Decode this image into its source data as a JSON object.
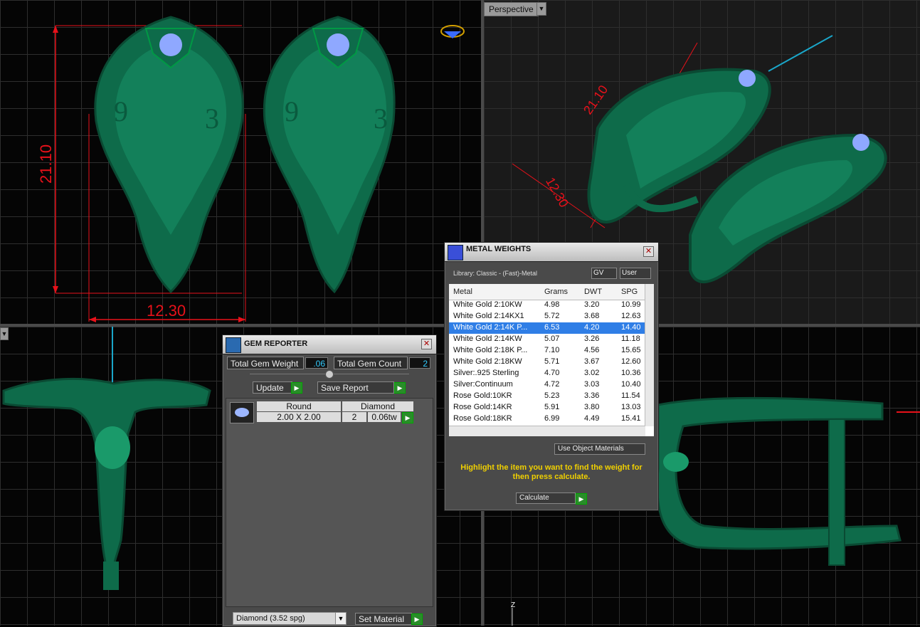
{
  "viewports": {
    "perspective_label": "Perspective",
    "top_dims": {
      "height": "21.10",
      "width": "12.30"
    },
    "persp_dims": {
      "height": "21.10",
      "width": "12.30"
    },
    "axis_label": "Z"
  },
  "gem_reporter": {
    "title": "GEM REPORTER",
    "total_weight_label": "Total Gem Weight",
    "total_weight_value": ".06",
    "total_count_label": "Total Gem Count",
    "total_count_value": "2",
    "update_label": "Update",
    "save_report_label": "Save Report",
    "row": {
      "shape": "Round",
      "size": "2.00 X 2.00",
      "material": "Diamond",
      "count": "2",
      "weight": "0.06tw"
    },
    "material_select": "Diamond      (3.52 spg)",
    "set_material_label": "Set Material"
  },
  "metal_weights": {
    "title": "METAL WEIGHTS",
    "library": "Library: Classic - (Fast)-Metal",
    "gv_label": "GV",
    "user_label": "User",
    "columns": [
      "Metal",
      "Grams",
      "DWT",
      "SPG"
    ],
    "rows": [
      {
        "metal": "White Gold 2:10KW",
        "grams": "4.98",
        "dwt": "3.20",
        "spg": "10.99"
      },
      {
        "metal": "White Gold 2:14KX1",
        "grams": "5.72",
        "dwt": "3.68",
        "spg": "12.63"
      },
      {
        "metal": "White Gold 2:14K P...",
        "grams": "6.53",
        "dwt": "4.20",
        "spg": "14.40"
      },
      {
        "metal": "White Gold 2:14KW",
        "grams": "5.07",
        "dwt": "3.26",
        "spg": "11.18"
      },
      {
        "metal": "White Gold 2:18K P...",
        "grams": "7.10",
        "dwt": "4.56",
        "spg": "15.65"
      },
      {
        "metal": "White Gold 2:18KW",
        "grams": "5.71",
        "dwt": "3.67",
        "spg": "12.60"
      },
      {
        "metal": "Silver:.925 Sterling",
        "grams": "4.70",
        "dwt": "3.02",
        "spg": "10.36"
      },
      {
        "metal": "Silver:Continuum",
        "grams": "4.72",
        "dwt": "3.03",
        "spg": "10.40"
      },
      {
        "metal": "Rose Gold:10KR",
        "grams": "5.23",
        "dwt": "3.36",
        "spg": "11.54"
      },
      {
        "metal": "Rose Gold:14KR",
        "grams": "5.91",
        "dwt": "3.80",
        "spg": "13.03"
      },
      {
        "metal": "Rose Gold:18KR",
        "grams": "6.99",
        "dwt": "4.49",
        "spg": "15.41"
      }
    ],
    "selected_index": 2,
    "use_object_materials": "Use Object Materials",
    "hint": "Highlight the item you want to find the weight for then press calculate.",
    "calculate_label": "Calculate"
  },
  "colors": {
    "model": "#0e6b4a",
    "dimension": "#e8111a",
    "selection": "#2f7ee6",
    "hint": "#f0d000"
  }
}
